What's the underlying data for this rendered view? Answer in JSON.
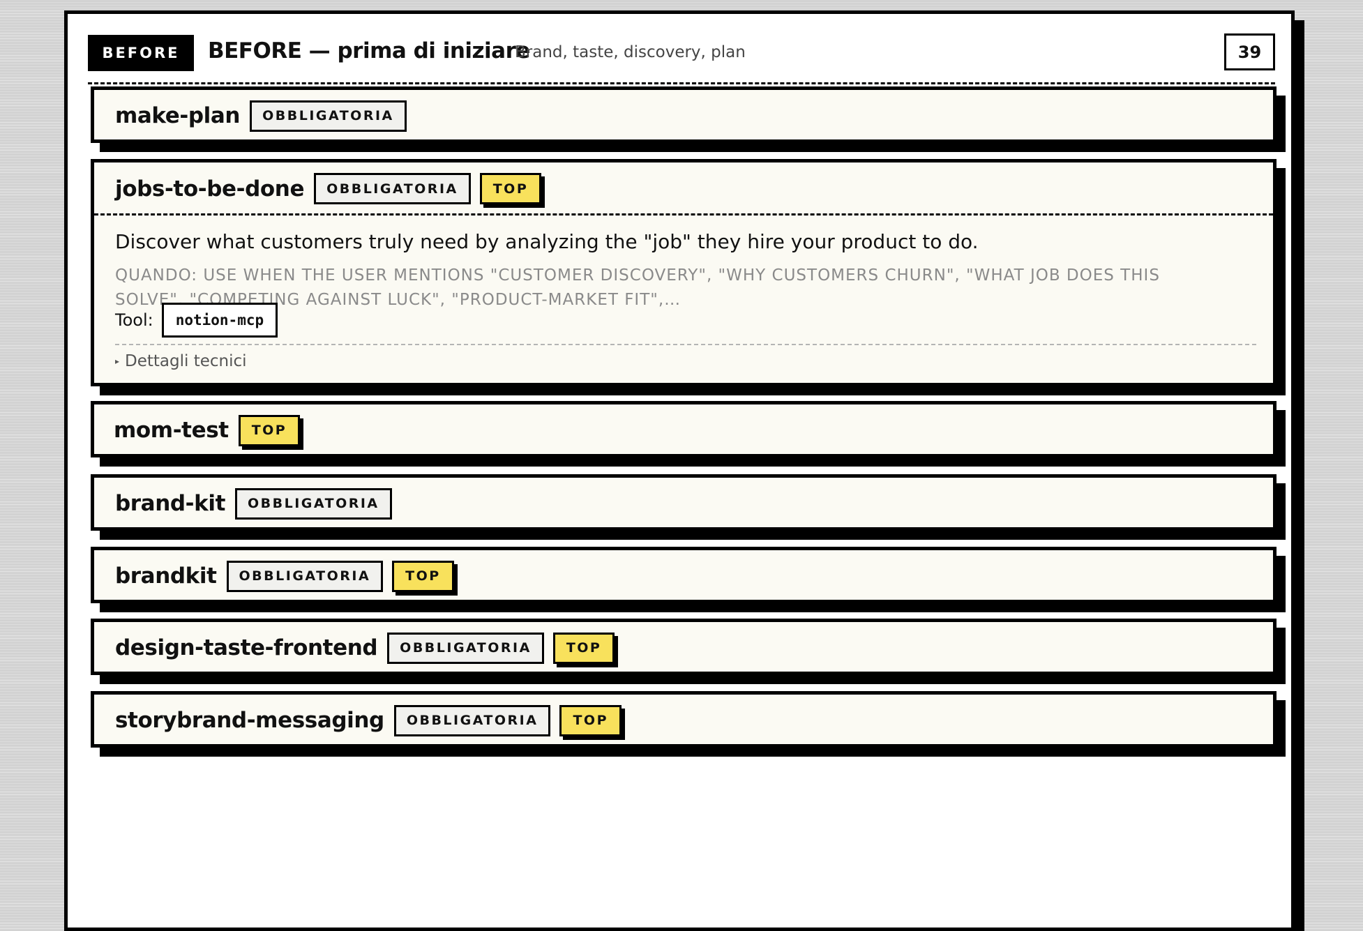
{
  "section": {
    "badge": "BEFORE",
    "title": "BEFORE — prima di iniziare",
    "subtitle": "Brand, taste, discovery, plan",
    "count": "39"
  },
  "labels": {
    "required": "OBBLIGATORIA",
    "top": "TOP",
    "tool": "Tool:",
    "details": "Dettagli tecnici"
  },
  "skills": [
    {
      "name": "make-plan",
      "required": true,
      "top": false,
      "expanded": false
    },
    {
      "name": "jobs-to-be-done",
      "required": true,
      "top": true,
      "expanded": true,
      "description": "Discover what customers truly need by analyzing the \"job\" they hire your product to do.",
      "trigger": "QUANDO: USE WHEN THE USER MENTIONS \"CUSTOMER DISCOVERY\", \"WHY CUSTOMERS CHURN\", \"WHAT JOB DOES THIS SOLVE\", \"COMPETING AGAINST LUCK\", \"PRODUCT-MARKET FIT\",…",
      "tool": "notion-mcp"
    },
    {
      "name": "mom-test",
      "required": false,
      "top": true,
      "expanded": false
    },
    {
      "name": "brand-kit",
      "required": true,
      "top": false,
      "expanded": false
    },
    {
      "name": "brandkit",
      "required": true,
      "top": true,
      "expanded": false
    },
    {
      "name": "design-taste-frontend",
      "required": true,
      "top": true,
      "expanded": false
    },
    {
      "name": "storybrand-messaging",
      "required": true,
      "top": true,
      "expanded": false
    }
  ]
}
